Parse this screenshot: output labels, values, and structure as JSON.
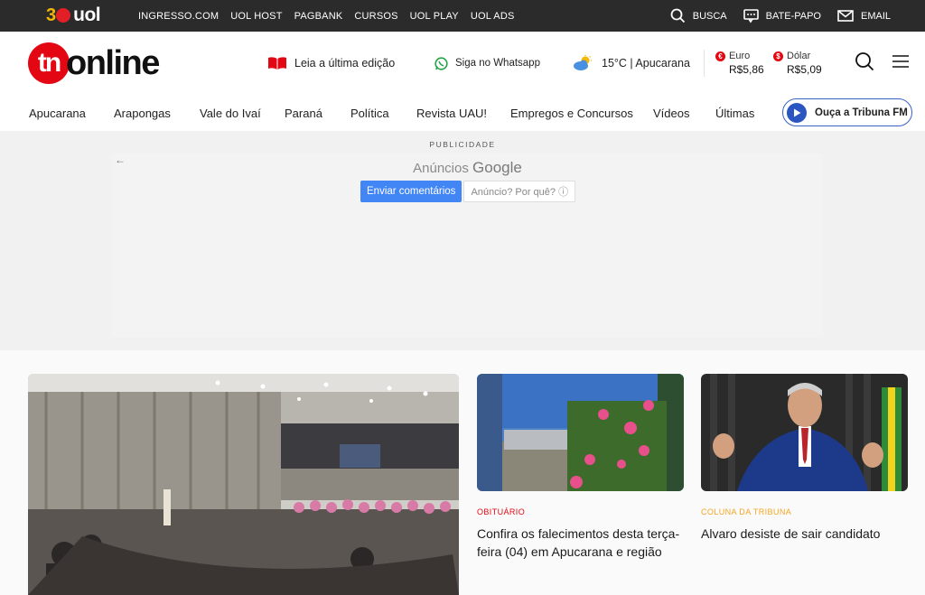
{
  "uolbar": {
    "logo_num": "30",
    "logo_text": "uol",
    "links": [
      "INGRESSO.COM",
      "UOL HOST",
      "PAGBANK",
      "CURSOS",
      "UOL PLAY",
      "UOL ADS"
    ],
    "busca": "BUSCA",
    "batepapo": "BATE-PAPO",
    "email": "EMAIL"
  },
  "header": {
    "logo_tn": "tn",
    "logo_online": "online",
    "edition": "Leia a última edição",
    "whatsapp": "Siga no Whatsapp",
    "weather": "15°C | Apucarana",
    "euro_label": "Euro",
    "euro_value": "R$5,86",
    "euro_symbol": "€",
    "dolar_label": "Dólar",
    "dolar_value": "R$5,09",
    "dolar_symbol": "$"
  },
  "nav": {
    "items": [
      "Apucarana",
      "Arapongas",
      "Vale do Ivaí",
      "Paraná",
      "Política",
      "Revista UAU!",
      "Empregos e Concursos",
      "Vídeos",
      "Últimas"
    ],
    "radio": "Ouça a Tribuna FM"
  },
  "ad": {
    "label": "PUBLICIDADE",
    "back": "←",
    "title_prefix": "Anúncios",
    "title_brand": "Google",
    "feedback": "Enviar comentários",
    "why": "Anúncio? Por quê? ⓘ"
  },
  "cards": [
    {
      "kicker": "OBITUÁRIO",
      "title": "Confira os falecimentos desta terça-feira (04) em Apucarana e região"
    },
    {
      "kicker": "COLUNA DA TRIBUNA",
      "title": "Alvaro desiste de sair candidato"
    }
  ],
  "colors": {
    "brand_red": "#e30613",
    "uol_bar": "#2b2b2b",
    "radio_blue": "#2b55c0",
    "google_blue": "#4285f4",
    "kicker_orange": "#f5a623"
  }
}
